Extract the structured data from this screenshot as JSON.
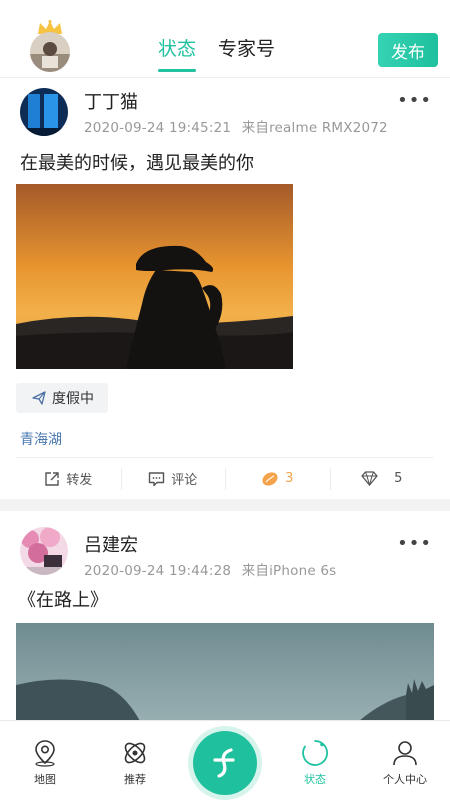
{
  "header": {
    "tabs": [
      {
        "label": "状态",
        "active": true
      },
      {
        "label": "专家号",
        "active": false
      }
    ],
    "publish_label": "发布"
  },
  "posts": [
    {
      "username": "丁丁猫",
      "timestamp": "2020-09-24 19:45:21",
      "source": "来自realme RMX2072",
      "text": "在最美的时候，遇见最美的你",
      "tag": "度假中",
      "location": "青海湖",
      "actions": {
        "repost_label": "转发",
        "comment_label": "评论",
        "like_count": "3",
        "gem_count": "5"
      }
    },
    {
      "username": "吕建宏",
      "timestamp": "2020-09-24 19:44:28",
      "source": "来自iPhone 6s",
      "text": "《在路上》"
    }
  ],
  "bottom_nav": [
    {
      "label": "地图",
      "icon": "map-pin-icon"
    },
    {
      "label": "推荐",
      "icon": "orbit-icon"
    },
    {
      "label": "",
      "icon": "plus-logo-icon"
    },
    {
      "label": "状态",
      "icon": "status-circle-icon",
      "active": true
    },
    {
      "label": "个人中心",
      "icon": "person-icon"
    }
  ],
  "colors": {
    "accent": "#21c2a0",
    "link": "#4a78b0",
    "like": "#f5a34b"
  }
}
